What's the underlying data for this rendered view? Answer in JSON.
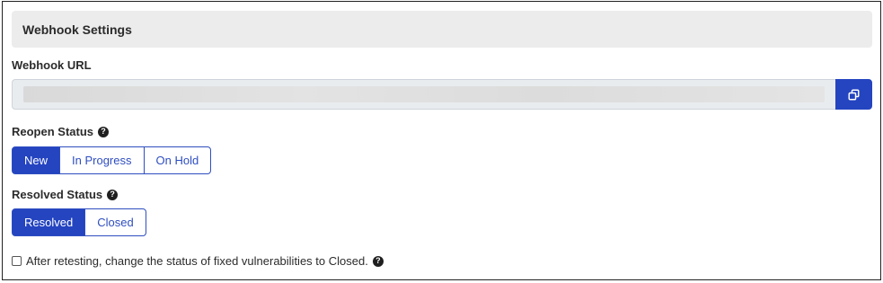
{
  "header": {
    "title": "Webhook Settings"
  },
  "webhook_url": {
    "label": "Webhook URL",
    "value": ""
  },
  "reopen_status": {
    "label": "Reopen Status",
    "options": [
      "New",
      "In Progress",
      "On Hold"
    ],
    "selected": "New"
  },
  "resolved_status": {
    "label": "Resolved Status",
    "options": [
      "Resolved",
      "Closed"
    ],
    "selected": "Resolved"
  },
  "retest_option": {
    "label": "After retesting, change the status of fixed vulnerabilities to Closed.",
    "checked": false
  },
  "icons": {
    "help": "question-circle-icon",
    "copy": "copy-icon"
  },
  "colors": {
    "accent": "#2444c0",
    "header_bg": "#ececec"
  }
}
